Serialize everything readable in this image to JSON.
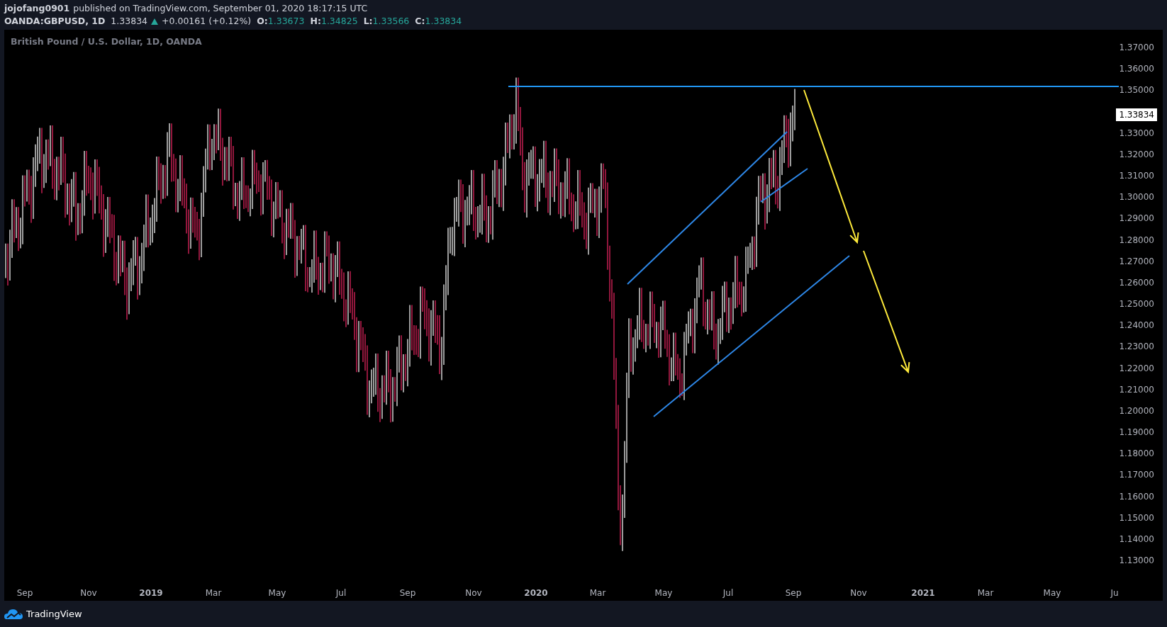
{
  "header": {
    "author": "jojofang0901",
    "published": "published on TradingView.com, September 01, 2020 18:17:15 UTC"
  },
  "symbol_line": {
    "symbol": "OANDA:GBPUSD, 1D",
    "last": "1.33834",
    "change": "+0.00161 (+0.12%)",
    "ohlc": [
      {
        "label": "O:",
        "value": "1.33673"
      },
      {
        "label": "H:",
        "value": "1.34825"
      },
      {
        "label": "L:",
        "value": "1.33566"
      },
      {
        "label": "C:",
        "value": "1.33834"
      }
    ]
  },
  "chart": {
    "title": "British Pound / U.S. Dollar, 1D, OANDA",
    "price_labels": [
      "1.37000",
      "1.36000",
      "1.35000",
      "1.33000",
      "1.32000",
      "1.31000",
      "1.30000",
      "1.29000",
      "1.28000",
      "1.27000",
      "1.26000",
      "1.25000",
      "1.24000",
      "1.23000",
      "1.22000",
      "1.21000",
      "1.20000",
      "1.19000",
      "1.18000",
      "1.17000",
      "1.16000",
      "1.15000",
      "1.14000",
      "1.13000"
    ],
    "last_price_label": "1.33834",
    "time_labels": [
      {
        "text": "Sep",
        "major": false
      },
      {
        "text": "Nov",
        "major": false
      },
      {
        "text": "2019",
        "major": true
      },
      {
        "text": "Mar",
        "major": false
      },
      {
        "text": "May",
        "major": false
      },
      {
        "text": "Jul",
        "major": false
      },
      {
        "text": "Sep",
        "major": false
      },
      {
        "text": "Nov",
        "major": false
      },
      {
        "text": "2020",
        "major": true
      },
      {
        "text": "Mar",
        "major": false
      },
      {
        "text": "May",
        "major": false
      },
      {
        "text": "Jul",
        "major": false
      },
      {
        "text": "Sep",
        "major": false
      },
      {
        "text": "Nov",
        "major": false
      },
      {
        "text": "2021",
        "major": true
      },
      {
        "text": "Mar",
        "major": false
      },
      {
        "text": "May",
        "major": false
      },
      {
        "text": "Ju",
        "major": false
      }
    ]
  },
  "footer": {
    "brand": "TradingView"
  }
}
